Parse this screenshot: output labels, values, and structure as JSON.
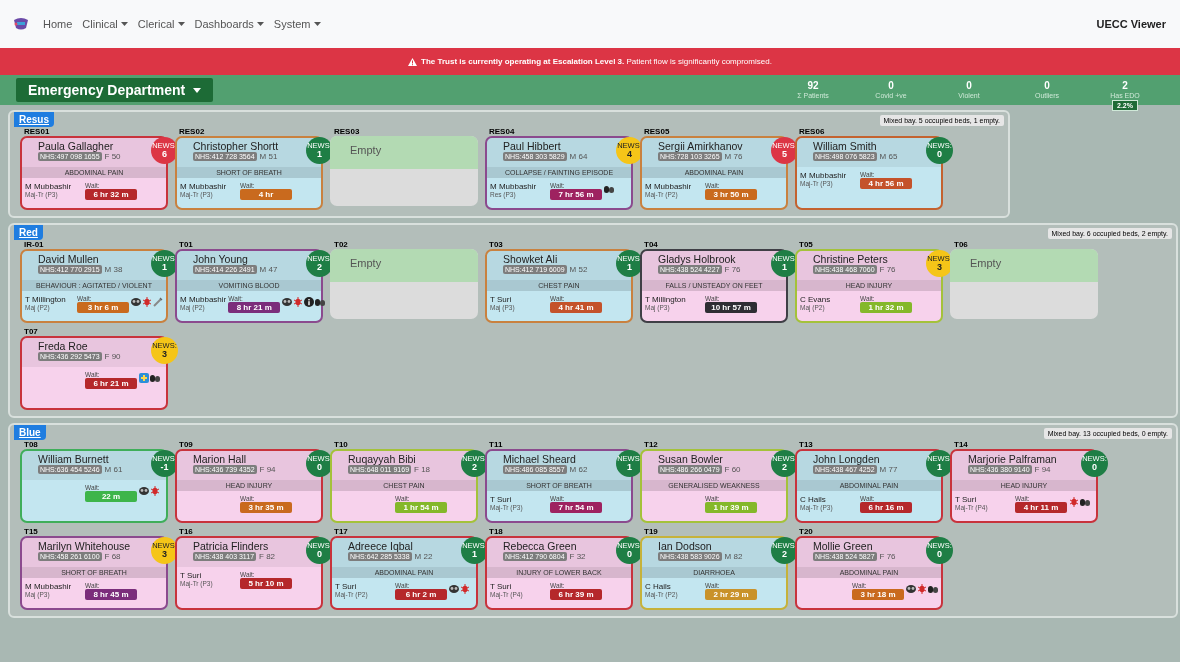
{
  "nav": {
    "items": [
      {
        "label": "Home",
        "has_menu": false
      },
      {
        "label": "Clinical",
        "has_menu": true
      },
      {
        "label": "Clerical",
        "has_menu": true
      },
      {
        "label": "Dashboards",
        "has_menu": true
      },
      {
        "label": "System",
        "has_menu": true
      }
    ],
    "app_name": "UECC Viewer"
  },
  "alert": {
    "text": "**The Trust is currently operating at Escalation Level 3.** Patient flow is significantly compromised."
  },
  "department": {
    "label": "Emergency Department"
  },
  "stats": [
    {
      "value": "92",
      "label": "Σ Patients"
    },
    {
      "value": "0",
      "label": "Covid +ve"
    },
    {
      "value": "0",
      "label": "Violent"
    },
    {
      "value": "0",
      "label": "Outliers"
    },
    {
      "value": "2",
      "label": "Has EDO",
      "badge": "2.2%"
    }
  ],
  "sections": [
    {
      "name": "Resus",
      "note": "Mixed bay. 5 occupied beds, 1 empty.",
      "beds": [
        {
          "bed": "RES01",
          "kind": "patient",
          "color": "#f7d2ec",
          "border": {
            "color": "#c8333c"
          },
          "name": "Paula Gallagher",
          "nhs": "NHS:497 098 1655",
          "sex_age": "F 50",
          "news": {
            "label": "NEWS:",
            "score": "6",
            "color": "#dc3545"
          },
          "complaint": "ABDOMINAL PAIN",
          "clinician": "M Mubbashir",
          "stream": "Maj-Tr (P3)",
          "wait": {
            "label": "Wait:",
            "time": "6 hr 32 m",
            "color": "#b5282b"
          }
        },
        {
          "bed": "RES02",
          "kind": "patient",
          "color": "#c3e6f0",
          "border": {
            "color": "#c9813f"
          },
          "name": "Christopher Shortt",
          "nhs": "NHS:412 728 3564",
          "sex_age": "M 51",
          "news": {
            "label": "NEWS:",
            "score": "1",
            "color": "#1e7e45"
          },
          "complaint": "SHORT OF BREATH",
          "clinician": "M Mubbashir",
          "stream": "Maj-Tr (P3)",
          "wait": {
            "label": "Wait:",
            "time": "4 hr",
            "color": "#c96a1e"
          }
        },
        {
          "bed": "RES03",
          "kind": "empty",
          "status": "Empty"
        },
        {
          "bed": "RES04",
          "kind": "patient",
          "color": "#c3e6f0",
          "border": {
            "color": "#8b4a8e"
          },
          "name": "Paul Hibbert",
          "nhs": "NHS:458 303 5829",
          "sex_age": "M 64",
          "news": {
            "label": "NEWS:",
            "score": "4",
            "color": "#f5c518"
          },
          "complaint": "COLLAPSE / FAINTING EPISODE",
          "clinician": "M Mubbashir",
          "stream": "Res (P3)",
          "wait": {
            "label": "Wait:",
            "time": "7 hr 56 m",
            "color": "#9e2260"
          },
          "icons": [
            {
              "kind": "pills"
            }
          ]
        },
        {
          "bed": "RES05",
          "kind": "patient",
          "color": "#c3e6f0",
          "border": {
            "color": "#c9813f"
          },
          "name": "Sergii Amirkhanov",
          "nhs": "NHS:728 103 3265",
          "sex_age": "M 76",
          "news": {
            "label": "NEWS:",
            "score": "5",
            "color": "#dc3545"
          },
          "complaint": "ABDOMINAL PAIN",
          "clinician": "M Mubbashir",
          "stream": "Maj-Tr (P2)",
          "wait": {
            "label": "Wait:",
            "time": "3 hr 50 m",
            "color": "#c96a1e"
          }
        },
        {
          "bed": "RES06",
          "kind": "patient",
          "color": "#c3e6f0",
          "border": {
            "color": "#c4622f"
          },
          "name": "William Smith",
          "nhs": "NHS:498 076 5823",
          "sex_age": "M 65",
          "news": {
            "label": "NEWS:",
            "score": "0",
            "color": "#1e7e45"
          },
          "clinician": "M Mubbashir",
          "stream": "Maj-Tr (P3)",
          "wait": {
            "label": "Wait:",
            "time": "4 hr 56 m",
            "color": "#c4522a"
          }
        }
      ]
    },
    {
      "name": "Red",
      "note": "Mixed bay. 6 occupied beds, 2 empty.",
      "beds": [
        {
          "bed": "IR-01",
          "kind": "patient",
          "color": "#c3e6f0",
          "border": {
            "color": "#c9813f"
          },
          "name": "David Mullen",
          "nhs": "NHS:412 770 2915",
          "sex_age": "M 38",
          "news": {
            "label": "NEWS:",
            "score": "1",
            "color": "#1e7e45"
          },
          "complaint": "BEHAVIOUR : AGITATED / VIOLENT",
          "clinician": "T Millington",
          "stream": "Maj (P2)",
          "wait": {
            "label": "Wait:",
            "time": "3 hr 6 m",
            "color": "#c96a1e"
          },
          "icons": [
            {
              "kind": "mask"
            },
            {
              "kind": "bug"
            },
            {
              "kind": "syringe"
            }
          ]
        },
        {
          "bed": "T01",
          "kind": "patient",
          "color": "#c3e6f0",
          "border": {
            "color": "#8b4a8e"
          },
          "name": "John Young",
          "nhs": "NHS:414 226 2491",
          "sex_age": "M 47",
          "news": {
            "label": "NEWS:",
            "score": "2",
            "color": "#1e7e45"
          },
          "complaint": "VOMITING BLOOD",
          "clinician": "M Mubbashir",
          "stream": "Maj (P2)",
          "wait": {
            "label": "Wait:",
            "time": "8 hr 21 m",
            "color": "#7b2d7b"
          },
          "icons": [
            {
              "kind": "mask"
            },
            {
              "kind": "bug"
            },
            {
              "kind": "info"
            },
            {
              "kind": "pills"
            }
          ]
        },
        {
          "bed": "T02",
          "kind": "empty",
          "status": "Empty"
        },
        {
          "bed": "T03",
          "kind": "patient",
          "color": "#c3e6f0",
          "border": {
            "color": "#c9813f"
          },
          "name": "Showket Ali",
          "nhs": "NHS:412 719 6009",
          "sex_age": "M 52",
          "news": {
            "label": "NEWS:",
            "score": "1",
            "color": "#1e7e45"
          },
          "complaint": "CHEST PAIN",
          "clinician": "T Suri",
          "stream": "Maj (P3)",
          "wait": {
            "label": "Wait:",
            "time": "4 hr 41 m",
            "color": "#c4522a"
          }
        },
        {
          "bed": "T04",
          "kind": "patient",
          "color": "#f7d2ec",
          "border": {
            "color": "#3f3f46"
          },
          "name": "Gladys Holbrook",
          "nhs": "NHS:438 524 4227",
          "sex_age": "F 76",
          "news": {
            "label": "NEWS:",
            "score": "1",
            "color": "#1e7e45"
          },
          "complaint": "FALLS / UNSTEADY ON FEET",
          "clinician": "T Millington",
          "stream": "Maj (P3)",
          "wait": {
            "label": "Wait:",
            "time": "10 hr 57 m",
            "color": "#2e2e33"
          }
        },
        {
          "bed": "T05",
          "kind": "patient",
          "color": "#f7d2ec",
          "border": {
            "color": "#a4c23a"
          },
          "name": "Christine Peters",
          "nhs": "NHS:438 468 7060",
          "sex_age": "F 76",
          "news": {
            "label": "NEWS:",
            "score": "3",
            "color": "#f5c518"
          },
          "complaint": "HEAD INJURY",
          "clinician": "C Evans",
          "stream": "Maj (P2)",
          "wait": {
            "label": "Wait:",
            "time": "1 hr 32 m",
            "color": "#84b82a"
          }
        },
        {
          "bed": "T06",
          "kind": "empty",
          "status": "Empty"
        },
        {
          "bed": "T07",
          "kind": "patient",
          "color": "#f7d2ec",
          "border": {
            "color": "#c8333c"
          },
          "name": "Freda Roe",
          "nhs": "NHS:436 292 5473",
          "sex_age": "F 90",
          "news": {
            "label": "NEWS:",
            "score": "3",
            "color": "#f5c518"
          },
          "wait": {
            "label": "Wait:",
            "time": "6 hr 21 m",
            "color": "#b5282b"
          },
          "icons": [
            {
              "kind": "plus"
            },
            {
              "kind": "pills"
            }
          ]
        }
      ]
    },
    {
      "name": "Blue",
      "note": "Mixed bay. 13 occupied beds, 0 empty.",
      "beds": [
        {
          "bed": "T08",
          "kind": "patient",
          "color": "#c3e6f0",
          "border": {
            "color": "#3fae5a"
          },
          "name": "William Burnett",
          "nhs": "NHS:636 454 5246",
          "sex_age": "M 61",
          "news": {
            "label": "NEWS:",
            "score": "-1",
            "color": "#1e7e45"
          },
          "wait": {
            "label": "Wait:",
            "time": "22 m",
            "color": "#3db54a"
          },
          "icons": [
            {
              "kind": "mask"
            },
            {
              "kind": "bug"
            }
          ]
        },
        {
          "bed": "T09",
          "kind": "patient",
          "color": "#f7d2ec",
          "border": {
            "color": "#c8333c"
          },
          "name": "Marion Hall",
          "nhs": "NHS:436 739 4352",
          "sex_age": "F 94",
          "news": {
            "label": "NEWS:",
            "score": "0",
            "color": "#1e7e45"
          },
          "complaint": "HEAD INJURY",
          "wait": {
            "label": "Wait:",
            "time": "3 hr 35 m",
            "color": "#c96a1e"
          }
        },
        {
          "bed": "T10",
          "kind": "patient",
          "color": "#f7d2ec",
          "border": {
            "color": "#a4c23a"
          },
          "name": "Ruqayyah Bibi",
          "nhs": "NHS:648 011 9169",
          "sex_age": "F 18",
          "news": {
            "label": "NEWS:",
            "score": "2",
            "color": "#1e7e45"
          },
          "complaint": "CHEST PAIN",
          "wait": {
            "label": "Wait:",
            "time": "1 hr 54 m",
            "color": "#84b82a"
          }
        },
        {
          "bed": "T11",
          "kind": "patient",
          "color": "#c3e6f0",
          "border": {
            "color": "#8b4a8e"
          },
          "name": "Michael Sheard",
          "nhs": "NHS:486 085 8557",
          "sex_age": "M 62",
          "news": {
            "label": "NEWS:",
            "score": "1",
            "color": "#1e7e45"
          },
          "complaint": "SHORT OF BREATH",
          "clinician": "T Suri",
          "stream": "Maj-Tr (P3)",
          "wait": {
            "label": "Wait:",
            "time": "7 hr 54 m",
            "color": "#9e2260"
          }
        },
        {
          "bed": "T12",
          "kind": "patient",
          "color": "#f7d2ec",
          "border": {
            "color": "#a4c23a"
          },
          "name": "Susan Bowler",
          "nhs": "NHS:486 266 0479",
          "sex_age": "F 60",
          "news": {
            "label": "NEWS:",
            "score": "2",
            "color": "#1e7e45"
          },
          "complaint": "GENERALISED WEAKNESS",
          "wait": {
            "label": "Wait:",
            "time": "1 hr 39 m",
            "color": "#84b82a"
          }
        },
        {
          "bed": "T13",
          "kind": "patient",
          "color": "#c3e6f0",
          "border": {
            "color": "#c8333c"
          },
          "name": "John Longden",
          "nhs": "NHS:438 467 4252",
          "sex_age": "M 77",
          "news": {
            "label": "NEWS:",
            "score": "1",
            "color": "#1e7e45"
          },
          "complaint": "ABDOMINAL PAIN",
          "clinician": "C Hails",
          "stream": "Maj-Tr (P3)",
          "wait": {
            "label": "Wait:",
            "time": "6 hr 16 m",
            "color": "#b5282b"
          }
        },
        {
          "bed": "T14",
          "kind": "patient",
          "color": "#f7d2ec",
          "border": {
            "color": "#c8333c"
          },
          "name": "Marjorie Palframan",
          "nhs": "NHS:436 380 9140",
          "sex_age": "F 94",
          "news": {
            "label": "NEWS:",
            "score": "0",
            "color": "#1e7e45"
          },
          "complaint": "HEAD INJURY",
          "clinician": "T Suri",
          "stream": "Maj-Tr (P4)",
          "wait": {
            "label": "Wait:",
            "time": "4 hr 11 m",
            "color": "#b5282b"
          },
          "icons": [
            {
              "kind": "bug"
            },
            {
              "kind": "pills"
            }
          ]
        },
        {
          "bed": "T15",
          "kind": "patient",
          "color": "#f7d2ec",
          "border": {
            "color": "#8b4a8e"
          },
          "name": "Marilyn Whitehouse",
          "nhs": "NHS:458 261 6100",
          "sex_age": "F 68",
          "news": {
            "label": "NEWS:",
            "score": "3",
            "color": "#f5c518"
          },
          "complaint": "SHORT OF BREATH",
          "clinician": "M Mubbashir",
          "stream": "Maj (P3)",
          "wait": {
            "label": "Wait:",
            "time": "8 hr 45 m",
            "color": "#7b2d7b"
          }
        },
        {
          "bed": "T16",
          "kind": "patient",
          "color": "#f7d2ec",
          "border": {
            "color": "#c8333c"
          },
          "name": "Patricia Flinders",
          "nhs": "NHS:438 403 3117",
          "sex_age": "F 82",
          "news": {
            "label": "NEWS:",
            "score": "0",
            "color": "#1e7e45"
          },
          "clinician": "T Suri",
          "stream": "Maj-Tr (P3)",
          "wait": {
            "label": "Wait:",
            "time": "5 hr 10 m",
            "color": "#b5282b"
          }
        },
        {
          "bed": "T17",
          "kind": "patient",
          "color": "#c3e6f0",
          "border": {
            "color": "#c8333c"
          },
          "name": "Adreece Iqbal",
          "nhs": "NHS:642 285 5338",
          "sex_age": "M 22",
          "news": {
            "label": "NEWS:",
            "score": "1",
            "color": "#1e7e45"
          },
          "complaint": "ABDOMINAL PAIN",
          "clinician": "T Suri",
          "stream": "Maj-Tr (P2)",
          "wait": {
            "label": "Wait:",
            "time": "6 hr 2 m",
            "color": "#b5282b"
          },
          "icons": [
            {
              "kind": "mask"
            },
            {
              "kind": "bug"
            }
          ]
        },
        {
          "bed": "T18",
          "kind": "patient",
          "color": "#f7d2ec",
          "border": {
            "color": "#c8333c"
          },
          "name": "Rebecca Green",
          "nhs": "NHS:412 790 6804",
          "sex_age": "F 32",
          "news": {
            "label": "NEWS:",
            "score": "0",
            "color": "#1e7e45"
          },
          "complaint": "INJURY OF LOWER BACK",
          "clinician": "T Suri",
          "stream": "Maj-Tr (P4)",
          "wait": {
            "label": "Wait:",
            "time": "6 hr 39 m",
            "color": "#b5282b"
          }
        },
        {
          "bed": "T19",
          "kind": "patient",
          "color": "#c3e6f0",
          "border": {
            "color": "#c6b23a"
          },
          "name": "Ian Dodson",
          "nhs": "NHS:438 583 9026",
          "sex_age": "M 82",
          "news": {
            "label": "NEWS:",
            "score": "2",
            "color": "#1e7e45"
          },
          "complaint": "DIARRHOEA",
          "clinician": "C Hails",
          "stream": "Maj-Tr (P2)",
          "wait": {
            "label": "Wait:",
            "time": "2 hr 29 m",
            "color": "#c9922a"
          }
        },
        {
          "bed": "T20",
          "kind": "patient",
          "color": "#f7d2ec",
          "border": {
            "color": "#c8333c"
          },
          "name": "Mollie Green",
          "nhs": "NHS:438 524 5827",
          "sex_age": "F 76",
          "news": {
            "label": "NEWS:",
            "score": "0",
            "color": "#1e7e45"
          },
          "complaint": "ABDOMINAL PAIN",
          "wait": {
            "label": "Wait:",
            "time": "3 hr 18 m",
            "color": "#c96a1e"
          },
          "icons": [
            {
              "kind": "mask"
            },
            {
              "kind": "bug"
            },
            {
              "kind": "pills"
            }
          ]
        }
      ]
    }
  ]
}
